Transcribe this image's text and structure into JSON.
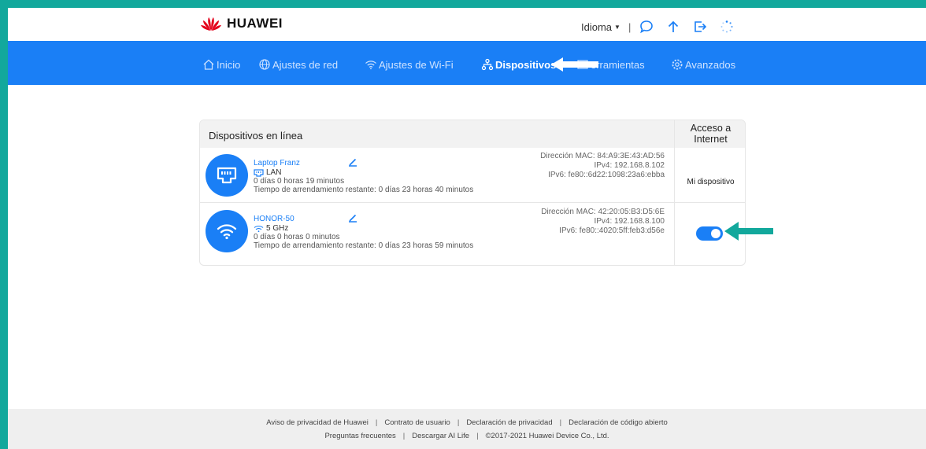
{
  "header": {
    "brand": "HUAWEI",
    "language_label": "Idioma",
    "brand_color": "#e3001b",
    "icons": [
      "chat-icon",
      "upload-icon",
      "logout-icon",
      "loading-spinner-icon"
    ]
  },
  "nav": {
    "items": [
      {
        "label": "Inicio",
        "icon": "home-icon"
      },
      {
        "label": "Ajustes de red",
        "icon": "globe-icon"
      },
      {
        "label": "Ajustes de Wi-Fi",
        "icon": "wifi-icon"
      },
      {
        "label": "Dispositivos",
        "icon": "devices-icon",
        "active": true
      },
      {
        "label": "erramientas",
        "icon": "tools-icon"
      },
      {
        "label": "Avanzados",
        "icon": "gear-icon"
      }
    ],
    "accent": "#1a7ff6"
  },
  "devices_panel": {
    "title": "Dispositivos en línea",
    "access_header": "Acceso a Internet",
    "devices": [
      {
        "name": "Laptop Franz",
        "connection": "LAN",
        "connected_time": "0 días 0 horas 19 minutos",
        "lease": "Tiempo de arrendamiento restante: 0 días 23 horas 40 minutos",
        "mac": "Dirección MAC: 84:A9:3E:43:AD:56",
        "ipv4": "IPv4: 192.168.8.102",
        "ipv6": "IPv6: fe80::6d22:1098:23a6:ebba",
        "access": "Mi dispositivo"
      },
      {
        "name": "HONOR-50",
        "connection": "5 GHz",
        "connected_time": "0 días 0 horas 0 minutos",
        "lease": "Tiempo de arrendamiento restante: 0 días 23 horas 59 minutos",
        "mac": "Dirección MAC: 42:20:05:B3:D5:6E",
        "ipv4": "IPv4: 192.168.8.100",
        "ipv6": "IPv6: fe80::4020:5ff:feb3:d56e",
        "access_enabled": true
      }
    ]
  },
  "annotations": {
    "white_arrow_color": "#ffffff",
    "teal_arrow_color": "#12a89c"
  },
  "footer": {
    "links_row1": [
      "Aviso de privacidad de Huawei",
      "Contrato de usuario",
      "Declaración de privacidad",
      "Declaración de código abierto"
    ],
    "links_row2": [
      "Preguntas frecuentes",
      "Descargar AI Life"
    ],
    "copyright": "©2017-2021 Huawei Device Co., Ltd."
  }
}
